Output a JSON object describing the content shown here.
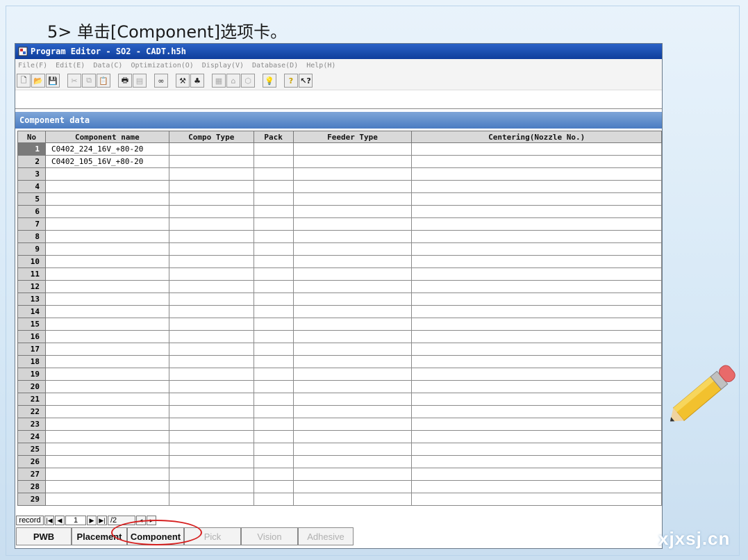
{
  "slide": {
    "title": "5> 单击[Component]选项卡。",
    "watermark": "xjxsj.cn"
  },
  "window": {
    "title": "Program Editor - SO2 - CADT.h5h",
    "menu": [
      "File(F)",
      "Edit(E)",
      "Data(C)",
      "Optimization(O)",
      "Display(V)",
      "Database(D)",
      "Help(H)"
    ],
    "toolbar_icons": [
      "new-file-icon",
      "open-folder-icon",
      "save-icon",
      "cut-icon",
      "copy-icon",
      "paste-icon",
      "print-icon",
      "print-preview-icon",
      "binoculars-icon",
      "tool-icon",
      "teach-icon",
      "grid-icon",
      "head-icon",
      "box-icon",
      "lightbulb-icon",
      "help-icon",
      "context-help-icon"
    ]
  },
  "panel": {
    "title": "Component data",
    "columns": [
      "No",
      "Component name",
      "Compo Type",
      "Pack",
      "Feeder Type",
      "Centering(Nozzle No.)"
    ],
    "rows": [
      {
        "no": "1",
        "name": "C0402_224_16V_+80-20",
        "type": "",
        "pack": "",
        "feeder": "",
        "centering": ""
      },
      {
        "no": "2",
        "name": "C0402_105_16V_+80-20",
        "type": "",
        "pack": "",
        "feeder": "",
        "centering": ""
      },
      {
        "no": "3",
        "name": "",
        "type": "",
        "pack": "",
        "feeder": "",
        "centering": ""
      },
      {
        "no": "4",
        "name": "",
        "type": "",
        "pack": "",
        "feeder": "",
        "centering": ""
      },
      {
        "no": "5",
        "name": "",
        "type": "",
        "pack": "",
        "feeder": "",
        "centering": ""
      },
      {
        "no": "6",
        "name": "",
        "type": "",
        "pack": "",
        "feeder": "",
        "centering": ""
      },
      {
        "no": "7",
        "name": "",
        "type": "",
        "pack": "",
        "feeder": "",
        "centering": ""
      },
      {
        "no": "8",
        "name": "",
        "type": "",
        "pack": "",
        "feeder": "",
        "centering": ""
      },
      {
        "no": "9",
        "name": "",
        "type": "",
        "pack": "",
        "feeder": "",
        "centering": ""
      },
      {
        "no": "10",
        "name": "",
        "type": "",
        "pack": "",
        "feeder": "",
        "centering": ""
      },
      {
        "no": "11",
        "name": "",
        "type": "",
        "pack": "",
        "feeder": "",
        "centering": ""
      },
      {
        "no": "12",
        "name": "",
        "type": "",
        "pack": "",
        "feeder": "",
        "centering": ""
      },
      {
        "no": "13",
        "name": "",
        "type": "",
        "pack": "",
        "feeder": "",
        "centering": ""
      },
      {
        "no": "14",
        "name": "",
        "type": "",
        "pack": "",
        "feeder": "",
        "centering": ""
      },
      {
        "no": "15",
        "name": "",
        "type": "",
        "pack": "",
        "feeder": "",
        "centering": ""
      },
      {
        "no": "16",
        "name": "",
        "type": "",
        "pack": "",
        "feeder": "",
        "centering": ""
      },
      {
        "no": "17",
        "name": "",
        "type": "",
        "pack": "",
        "feeder": "",
        "centering": ""
      },
      {
        "no": "18",
        "name": "",
        "type": "",
        "pack": "",
        "feeder": "",
        "centering": ""
      },
      {
        "no": "19",
        "name": "",
        "type": "",
        "pack": "",
        "feeder": "",
        "centering": ""
      },
      {
        "no": "20",
        "name": "",
        "type": "",
        "pack": "",
        "feeder": "",
        "centering": ""
      },
      {
        "no": "21",
        "name": "",
        "type": "",
        "pack": "",
        "feeder": "",
        "centering": ""
      },
      {
        "no": "22",
        "name": "",
        "type": "",
        "pack": "",
        "feeder": "",
        "centering": ""
      },
      {
        "no": "23",
        "name": "",
        "type": "",
        "pack": "",
        "feeder": "",
        "centering": ""
      },
      {
        "no": "24",
        "name": "",
        "type": "",
        "pack": "",
        "feeder": "",
        "centering": ""
      },
      {
        "no": "25",
        "name": "",
        "type": "",
        "pack": "",
        "feeder": "",
        "centering": ""
      },
      {
        "no": "26",
        "name": "",
        "type": "",
        "pack": "",
        "feeder": "",
        "centering": ""
      },
      {
        "no": "27",
        "name": "",
        "type": "",
        "pack": "",
        "feeder": "",
        "centering": ""
      },
      {
        "no": "28",
        "name": "",
        "type": "",
        "pack": "",
        "feeder": "",
        "centering": ""
      },
      {
        "no": "29",
        "name": "",
        "type": "",
        "pack": "",
        "feeder": "",
        "centering": ""
      }
    ],
    "selected_row": "1"
  },
  "record_nav": {
    "label": "record",
    "current": "1",
    "total": "/2"
  },
  "tabs": [
    {
      "label": "PWB",
      "enabled": true
    },
    {
      "label": "Placement",
      "enabled": true
    },
    {
      "label": "Component",
      "enabled": true
    },
    {
      "label": "Pick",
      "enabled": false
    },
    {
      "label": "Vision",
      "enabled": false
    },
    {
      "label": "Adhesive",
      "enabled": false
    }
  ],
  "colors": {
    "title_bar": "#1a4fb4",
    "panel_header": "#5a88c8",
    "highlight_oval": "#d62020"
  }
}
